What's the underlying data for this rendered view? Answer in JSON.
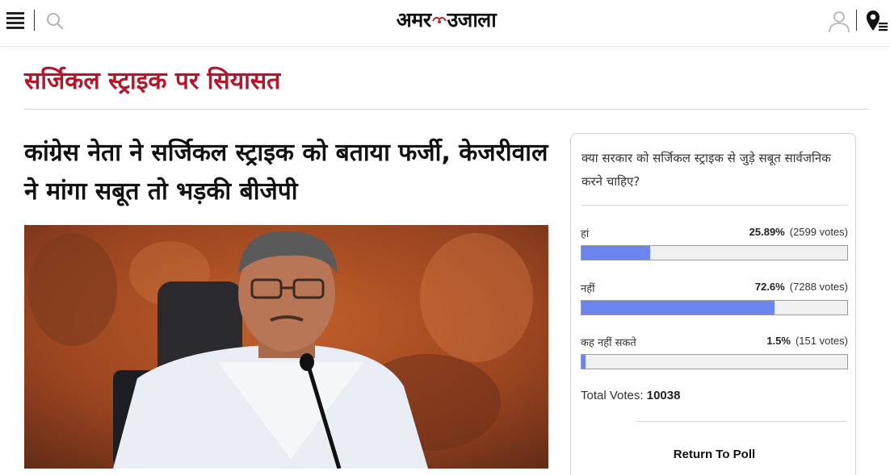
{
  "header": {
    "menu_icon": "hamburger-menu-icon",
    "search_icon": "search-icon",
    "logo_text_left": "अमर",
    "logo_text_right": "उजाला",
    "user_icon": "user-icon",
    "location_icon": "location-pin-icon"
  },
  "section": {
    "title": "सर्जिकल स्ट्राइक पर सियासत",
    "title_color": "#b8142a"
  },
  "article": {
    "headline": "कांग्रेस नेता ने सर्जिकल स्ट्राइक को बताया फर्जी, केजरीवाल ने मांगा सबूत तो भड़की बीजेपी"
  },
  "poll": {
    "question": "क्या सरकार को सर्जिकल स्ट्राइक से जुड़े सबूत सार्वजनिक करने चाहिए?",
    "options": [
      {
        "label": "हां",
        "percent": "25.89%",
        "votes": "(2599 votes)",
        "fraction": 0.2589
      },
      {
        "label": "नहीं",
        "percent": "72.6%",
        "votes": "(7288 votes)",
        "fraction": 0.726
      },
      {
        "label": "कह नहीं सकते",
        "percent": "1.5%",
        "votes": "(151 votes)",
        "fraction": 0.015
      }
    ],
    "total_label": "Total Votes:",
    "total_value": "10038",
    "return_label": "Return To Poll",
    "bar_color": "#6c84ee"
  }
}
